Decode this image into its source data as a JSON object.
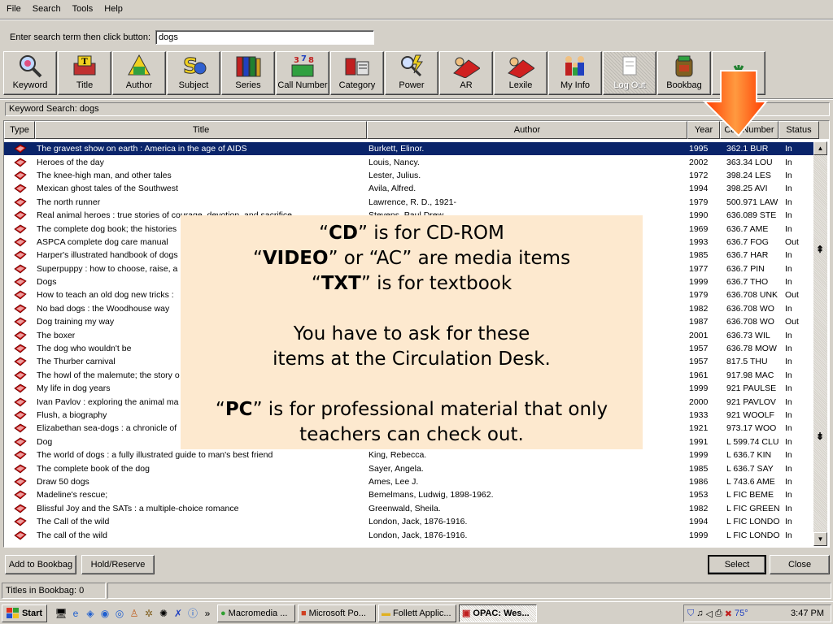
{
  "menu": [
    "File",
    "Search",
    "Tools",
    "Help"
  ],
  "search": {
    "label": "Enter search term then click button:",
    "value": "dogs"
  },
  "toolbar": [
    {
      "label": "Keyword",
      "icon": "keyword-icon"
    },
    {
      "label": "Title",
      "icon": "title-icon"
    },
    {
      "label": "Author",
      "icon": "author-icon"
    },
    {
      "label": "Subject",
      "icon": "subject-icon"
    },
    {
      "label": "Series",
      "icon": "series-icon"
    },
    {
      "label": "Call Number",
      "icon": "call-number-icon"
    },
    {
      "label": "Category",
      "icon": "category-icon"
    },
    {
      "label": "Power",
      "icon": "power-icon"
    },
    {
      "label": "AR",
      "icon": "ar-icon"
    },
    {
      "label": "Lexile",
      "icon": "lexile-icon"
    },
    {
      "label": "My Info",
      "icon": "my-info-icon"
    },
    {
      "label": "Log Out",
      "icon": "log-out-icon"
    },
    {
      "label": "Bookbag",
      "icon": "bookbag-icon"
    },
    {
      "label": "",
      "icon": "extra-icon"
    }
  ],
  "keyword_status": "Keyword Search: dogs",
  "table": {
    "headers": [
      "Type",
      "Title",
      "Author",
      "Year",
      "Call Number",
      "Status"
    ],
    "rows": [
      [
        "The gravest show on earth : America in the age of AIDS",
        "Burkett, Elinor.",
        "1995",
        "362.1 BUR",
        "In"
      ],
      [
        "Heroes of the day",
        "Louis, Nancy.",
        "2002",
        "363.34 LOU",
        "In"
      ],
      [
        "The knee-high man, and other tales",
        "Lester, Julius.",
        "1972",
        "398.24 LES",
        "In"
      ],
      [
        "Mexican ghost tales of the Southwest",
        "Avila, Alfred.",
        "1994",
        "398.25 AVI",
        "In"
      ],
      [
        "The north runner",
        "Lawrence, R. D., 1921-",
        "1979",
        "500.971 LAW",
        "In"
      ],
      [
        "Real animal heroes : true stories of courage, devotion, and sacrifice",
        "Stevens, Paul Drew.",
        "1990",
        "636.089 STE",
        "In"
      ],
      [
        "The complete dog book; the histories",
        "",
        "1969",
        "636.7 AME",
        "In"
      ],
      [
        "ASPCA complete dog care manual",
        "",
        "1993",
        "636.7 FOG",
        "Out"
      ],
      [
        "Harper's illustrated handbook of dogs",
        "",
        "1985",
        "636.7 HAR",
        "In"
      ],
      [
        "Superpuppy : how to choose, raise, a",
        "",
        "1977",
        "636.7 PIN",
        "In"
      ],
      [
        "Dogs",
        "",
        "1999",
        "636.7 THO",
        "In"
      ],
      [
        "How to teach an old dog new tricks :",
        "",
        "1979",
        "636.708 UNK",
        "Out"
      ],
      [
        "No bad dogs : the Woodhouse way",
        "",
        "1982",
        "636.708 WO",
        "In"
      ],
      [
        "Dog training my way",
        "",
        "1987",
        "636.708 WO",
        "Out"
      ],
      [
        "The boxer",
        "",
        "2001",
        "636.73 WIL",
        "In"
      ],
      [
        "The dog who wouldn't be",
        "",
        "1957",
        "636.78 MOW",
        "In"
      ],
      [
        "The Thurber carnival",
        "",
        "1957",
        "817.5 THU",
        "In"
      ],
      [
        "The howl of the malemute; the story o",
        "",
        "1961",
        "917.98 MAC",
        "In"
      ],
      [
        "My life in dog years",
        "",
        "1999",
        "921 PAULSE",
        "In"
      ],
      [
        "Ivan Pavlov : exploring the animal ma",
        "",
        "2000",
        "921 PAVLOV",
        "In"
      ],
      [
        "Flush, a biography",
        "",
        "1933",
        "921 WOOLF",
        "In"
      ],
      [
        "Elizabethan sea-dogs : a chronicle of",
        "",
        "1921",
        "973.17 WOO",
        "In"
      ],
      [
        "Dog",
        "",
        "1991",
        "L 599.74 CLU",
        "In"
      ],
      [
        "The world of dogs : a fully illustrated guide to man's best friend",
        "King, Rebecca.",
        "1999",
        "L 636.7 KIN",
        "In"
      ],
      [
        "The complete book of the dog",
        "Sayer, Angela.",
        "1985",
        "L 636.7 SAY",
        "In"
      ],
      [
        "Draw 50 dogs",
        "Ames, Lee J.",
        "1986",
        "L 743.6 AME",
        "In"
      ],
      [
        "Madeline's rescue;",
        "Bemelmans, Ludwig, 1898-1962.",
        "1953",
        "L FIC BEME",
        "In"
      ],
      [
        "Blissful Joy and the SATs : a multiple-choice romance",
        "Greenwald, Sheila.",
        "1982",
        "L FIC GREEN",
        "In"
      ],
      [
        "The Call of the wild",
        "London, Jack, 1876-1916.",
        "1994",
        "L FIC LONDO",
        "In"
      ],
      [
        "The call of the wild",
        "London, Jack, 1876-1916.",
        "1999",
        "L FIC LONDO",
        "In"
      ]
    ]
  },
  "callout": {
    "l1_b": "CD",
    "l1_r": " is for CD-ROM",
    "l2_b": "VIDEO",
    "l2_r": " or “AC” are media items",
    "l3_b": "TXT",
    "l3_r": " is for textbook",
    "l4": "You have to ask for these",
    "l5": "items at the Circulation Desk.",
    "l6_b": "PC",
    "l6_r": " is for professional material that only",
    "l7": "teachers can check out."
  },
  "buttons": {
    "add_bookbag": "Add to Bookbag",
    "hold": "Hold/Reserve",
    "select": "Select",
    "close": "Close"
  },
  "bookbag_status": "Titles in Bookbag:  0",
  "taskbar": {
    "start": "Start",
    "tasks": [
      "Macromedia ...",
      "Microsoft Po...",
      "Follett Applic...",
      "OPAC: Wes..."
    ],
    "temp": "75°",
    "clock": "3:47 PM"
  },
  "colors": {
    "selection": "#0a246a",
    "callout_bg": "#fde9cf",
    "arrow": "#ff5a00",
    "book_red": "#cc1010"
  }
}
